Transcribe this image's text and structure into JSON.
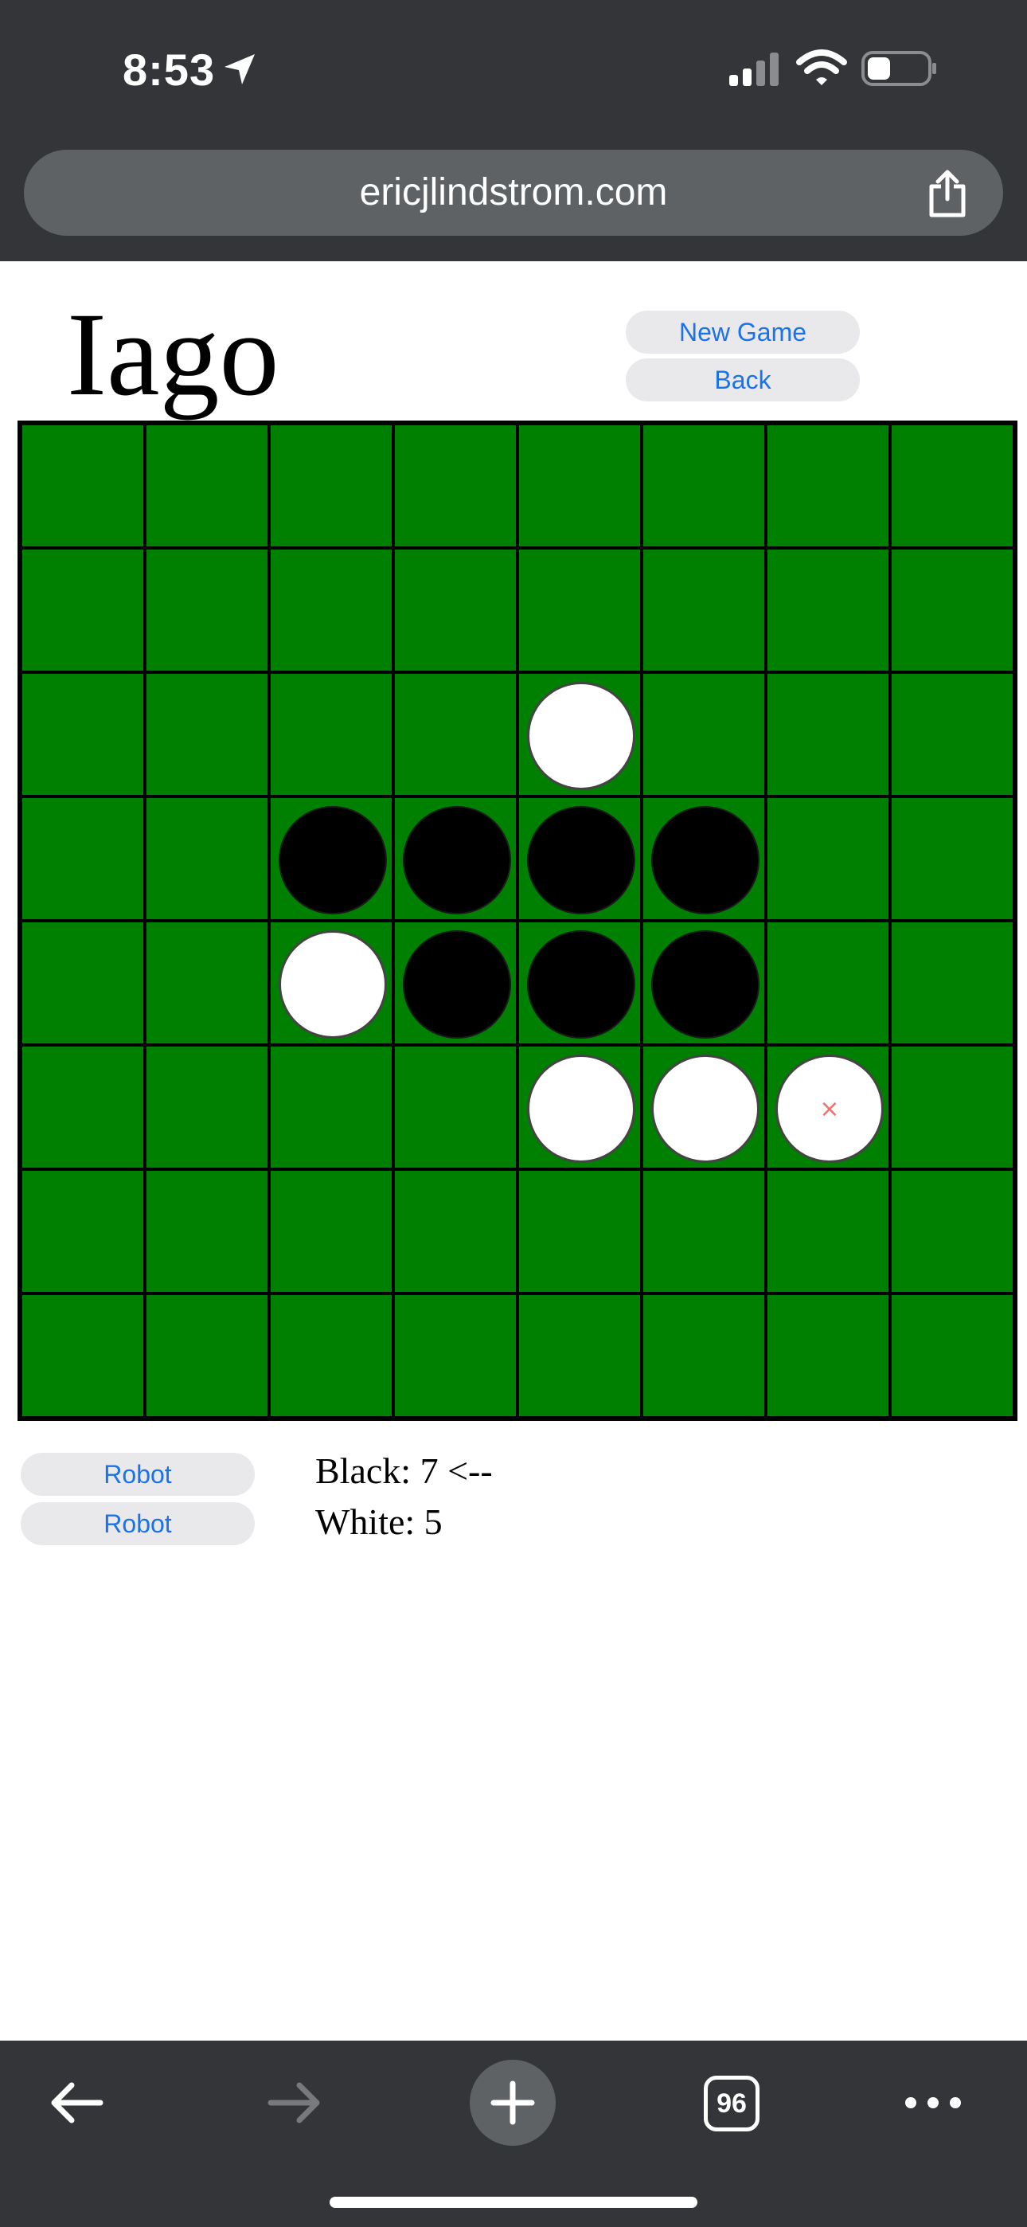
{
  "status_bar": {
    "time": "8:53",
    "icons": [
      "location-arrow-icon",
      "signal-icon",
      "wifi-icon",
      "battery-icon"
    ]
  },
  "browser": {
    "url": "ericjlindstrom.com",
    "tab_count": "96",
    "toolbar_icons": [
      "back-arrow-icon",
      "forward-arrow-icon",
      "new-tab-plus-icon",
      "tabs-icon",
      "more-icon"
    ]
  },
  "page": {
    "title": "Iago",
    "new_game_label": "New Game",
    "back_label": "Back",
    "player1_label": "Robot",
    "player2_label": "Robot",
    "black_score": "Black: 7 <--",
    "white_score": "White: 5"
  },
  "board": {
    "size": 8,
    "colors": {
      "board": "#008000",
      "black": "#000000",
      "white": "#ffffff",
      "last_move_mark": "#f07070"
    },
    "last_move_mark": "×",
    "last_move": [
      5,
      6
    ],
    "grid": [
      [
        "",
        "",
        "",
        "",
        "",
        "",
        "",
        ""
      ],
      [
        "",
        "",
        "",
        "",
        "",
        "",
        "",
        ""
      ],
      [
        "",
        "",
        "",
        "",
        "W",
        "",
        "",
        ""
      ],
      [
        "",
        "",
        "B",
        "B",
        "B",
        "B",
        "",
        ""
      ],
      [
        "",
        "",
        "W",
        "B",
        "B",
        "B",
        "",
        ""
      ],
      [
        "",
        "",
        "",
        "",
        "W",
        "W",
        "W",
        ""
      ],
      [
        "",
        "",
        "",
        "",
        "",
        "",
        "",
        ""
      ],
      [
        "",
        "",
        "",
        "",
        "",
        "",
        "",
        ""
      ]
    ]
  }
}
